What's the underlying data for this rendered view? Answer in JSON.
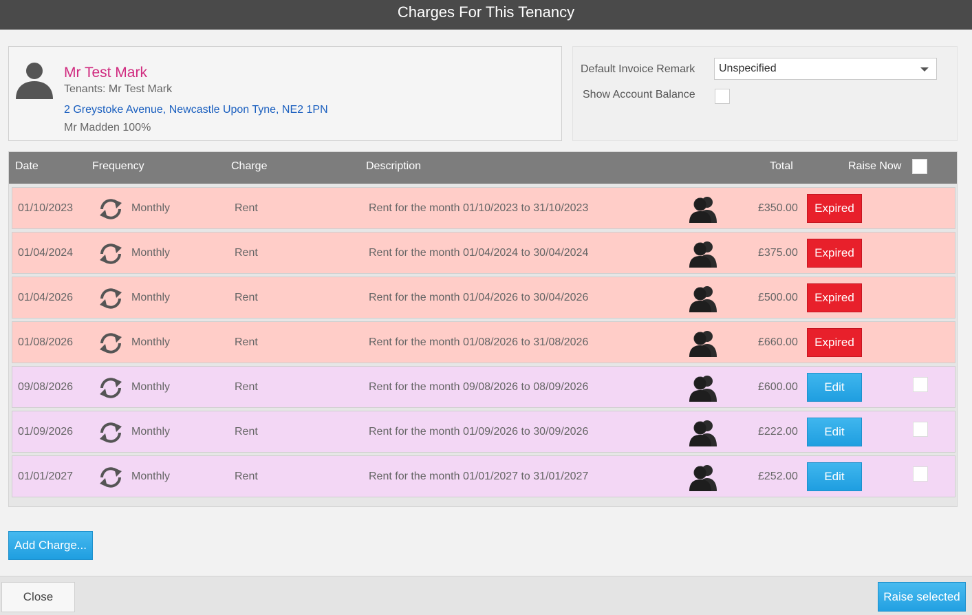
{
  "window": {
    "title": "Charges For This Tenancy"
  },
  "tenant": {
    "name": "Mr Test Mark",
    "tenants_line": "Tenants: Mr Test Mark",
    "address": "2 Greystoke Avenue, Newcastle Upon Tyne, NE2 1PN",
    "owner_line": "Mr Madden 100%"
  },
  "options": {
    "invoice_remark_label": "Default Invoice Remark",
    "invoice_remark_value": "Unspecified",
    "show_balance_label": "Show Account Balance",
    "show_balance_checked": false
  },
  "table": {
    "headers": {
      "date": "Date",
      "frequency": "Frequency",
      "charge": "Charge",
      "description": "Description",
      "total": "Total",
      "raise_now": "Raise Now"
    },
    "rows": [
      {
        "date": "01/10/2023",
        "frequency": "Monthly",
        "charge": "Rent",
        "description": "Rent for the month 01/10/2023 to 31/10/2023",
        "total": "£350.00",
        "status": "expired",
        "action": "Expired"
      },
      {
        "date": "01/04/2024",
        "frequency": "Monthly",
        "charge": "Rent",
        "description": "Rent for the month 01/04/2024 to 30/04/2024",
        "total": "£375.00",
        "status": "expired",
        "action": "Expired"
      },
      {
        "date": "01/04/2026",
        "frequency": "Monthly",
        "charge": "Rent",
        "description": "Rent for the month 01/04/2026 to 30/04/2026",
        "total": "£500.00",
        "status": "expired",
        "action": "Expired"
      },
      {
        "date": "01/08/2026",
        "frequency": "Monthly",
        "charge": "Rent",
        "description": "Rent for the month 01/08/2026 to 31/08/2026",
        "total": "£660.00",
        "status": "expired",
        "action": "Expired"
      },
      {
        "date": "09/08/2026",
        "frequency": "Monthly",
        "charge": "Rent",
        "description": "Rent for the month 09/08/2026 to 08/09/2026",
        "total": "£600.00",
        "status": "active",
        "action": "Edit"
      },
      {
        "date": "01/09/2026",
        "frequency": "Monthly",
        "charge": "Rent",
        "description": "Rent for the month 01/09/2026 to 30/09/2026",
        "total": "£222.00",
        "status": "active",
        "action": "Edit"
      },
      {
        "date": "01/01/2027",
        "frequency": "Monthly",
        "charge": "Rent",
        "description": "Rent for the month 01/01/2027 to 31/01/2027",
        "total": "£252.00",
        "status": "active",
        "action": "Edit"
      }
    ]
  },
  "buttons": {
    "add_charge": "Add Charge...",
    "close": "Close",
    "raise_selected": "Raise selected"
  },
  "icons": {
    "avatar": "person-silhouette-icon",
    "frequency": "refresh-cycle-icon",
    "tenant": "people-icon"
  },
  "colors": {
    "expired_row": "#ffcdc8",
    "active_row": "#f3d7f5",
    "expired_button": "#e8202b",
    "edit_button": "#1f9ee0",
    "tenant_name": "#d02a7f",
    "address_link": "#1a5fbf"
  }
}
